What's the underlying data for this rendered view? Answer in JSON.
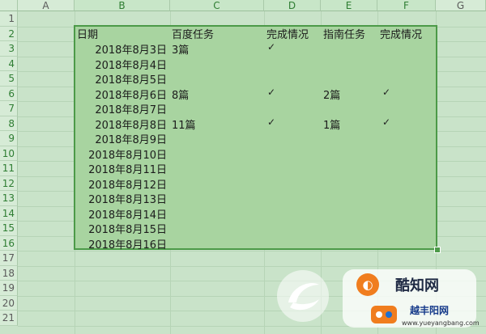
{
  "columns": [
    "A",
    "B",
    "C",
    "D",
    "E",
    "F",
    "G"
  ],
  "rows": [
    "1",
    "2",
    "3",
    "4",
    "5",
    "6",
    "7",
    "8",
    "9",
    "10",
    "11",
    "12",
    "13",
    "14",
    "15",
    "16",
    "17",
    "18",
    "19",
    "20",
    "21"
  ],
  "cells": {
    "headers": [
      "日期",
      "百度任务",
      "完成情况",
      "指南任务",
      "完成情况"
    ],
    "dates": [
      "2018年8月3日",
      "2018年8月4日",
      "2018年8月5日",
      "2018年8月6日",
      "2018年8月7日",
      "2018年8月8日",
      "2018年8月9日",
      "2018年8月10日",
      "2018年8月11日",
      "2018年8月12日",
      "2018年8月13日",
      "2018年8月14日",
      "2018年8月15日",
      "2018年8月16日"
    ],
    "baidu": [
      "3篇",
      "",
      "",
      "8篇",
      "",
      "11篇"
    ],
    "baidu_done": [
      "✓",
      "",
      "",
      "✓",
      "",
      "✓"
    ],
    "guide": [
      "",
      "",
      "",
      "2篇",
      "",
      "1篇"
    ],
    "guide_done": [
      "",
      "",
      "",
      "✓",
      "",
      "✓"
    ]
  },
  "watermark": {
    "brand": "酷知网",
    "site": "越丰阳网",
    "url": "www.yueyangbang.com"
  },
  "colors": {
    "selection": "#a8d4a0",
    "selection_border": "#4c9a48",
    "background": "#c9e3c9"
  }
}
